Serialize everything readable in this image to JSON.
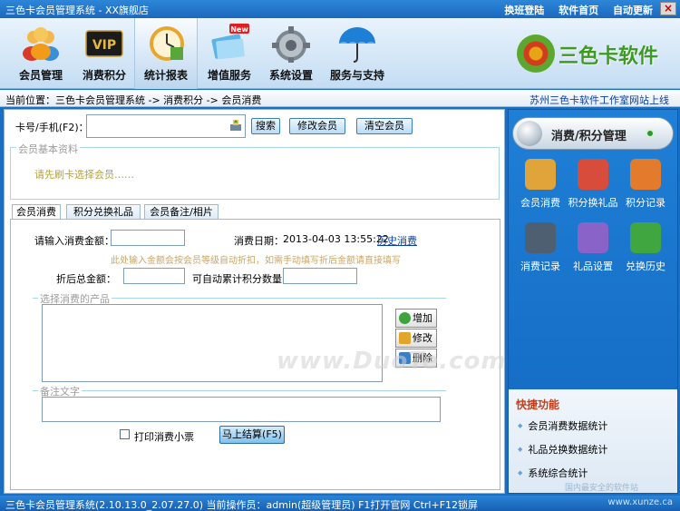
{
  "window": {
    "title": "三色卡会员管理系统 - XX旗舰店",
    "links": [
      "换班登陆",
      "软件首页",
      "自动更新"
    ],
    "close_glyph": "×"
  },
  "toolbar": {
    "items": [
      {
        "label": "会员管理",
        "icon": "members-icon"
      },
      {
        "label": "消费积分",
        "icon": "vip-card-icon"
      },
      {
        "label": "统计报表",
        "icon": "clock-report-icon"
      },
      {
        "label": "增值服务",
        "icon": "new-service-icon"
      },
      {
        "label": "系统设置",
        "icon": "gear-icon"
      },
      {
        "label": "服务与支持",
        "icon": "umbrella-icon"
      }
    ],
    "active_index": 2,
    "logo_text": "三色卡软件"
  },
  "breadcrumb": {
    "text": "当前位置：三色卡会员管理系统 -> 消费积分 -> 会员消费",
    "site_link": "苏州三色卡软件工作室网站上线"
  },
  "lookup": {
    "label": "卡号/手机(F2)：",
    "value": "",
    "search_button": "搜索",
    "edit_button": "修改会员",
    "clear_button": "清空会员"
  },
  "member_info": {
    "caption": "会员基本资料",
    "hint": "请先刷卡选择会员……"
  },
  "tabs": [
    "会员消费",
    "积分兑换礼品",
    "会员备注/相片"
  ],
  "consume": {
    "amount_label": "请输入消费金额：",
    "amount_value": "",
    "date_label": "消费日期：",
    "date_value": "2013-04-03 13:55:22",
    "history_link": "历史消费",
    "tip": "此处输入金额会按会员等级自动折扣，如需手动填写折后金额请直接填写",
    "discount_label": "折后总金额：",
    "discount_value": "",
    "points_label": "可自动累计积分数量：",
    "points_value": "",
    "products_caption": "选择消费的产品",
    "add_button": "增加",
    "edit_button": "修改",
    "delete_button": "删除",
    "remark_caption": "备注文字",
    "remark_value": "",
    "print_label": "打印消费小票",
    "print_checked": false,
    "settle_button": "马上结算(F5)"
  },
  "right_panel": {
    "header": "消费/积分管理",
    "buttons": [
      {
        "label": "会员消费",
        "icon": "consume-icon",
        "color": "#e0a43a"
      },
      {
        "label": "积分换礼品",
        "icon": "gift-icon",
        "color": "#d84c3c"
      },
      {
        "label": "积分记录",
        "icon": "tv-icon",
        "color": "#e37b2c"
      },
      {
        "label": "消费记录",
        "icon": "laptop-icon",
        "color": "#4f5f72"
      },
      {
        "label": "礼品设置",
        "icon": "share-icon",
        "color": "#8a63c8"
      },
      {
        "label": "兑换历史",
        "icon": "heart-bag-icon",
        "color": "#3fa640"
      }
    ],
    "quick": {
      "title": "快捷功能",
      "items": [
        "会员消费数据统计",
        "礼品兑换数据统计",
        "系统综合统计"
      ],
      "footer_watermark": "国内最安全的软件站"
    }
  },
  "status": {
    "text": "三色卡会员管理系统(2.10.13.0_2.07.27.0)  当前操作员：admin(超级管理员)  F1打开官网 Ctrl+F12锁屏",
    "right": "www.xunze.ca"
  },
  "watermark": "www.DuoTe.com"
}
